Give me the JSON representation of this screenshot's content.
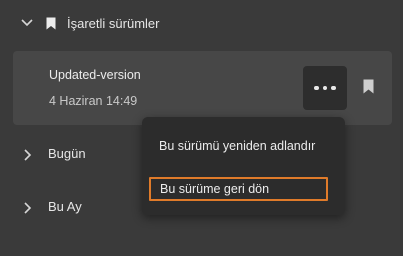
{
  "groups": {
    "marked": {
      "label": "İşaretli sürümler"
    },
    "today": {
      "label": "Bugün"
    },
    "this_month": {
      "label": "Bu Ay"
    }
  },
  "version": {
    "name": "Updated-version",
    "date": "4 Haziran 14:49"
  },
  "menu": {
    "rename_label": "Bu sürümü yeniden adlandır",
    "revert_label": "Bu sürüme geri dön"
  },
  "icons": {
    "expand": "chevron-down-icon",
    "collapsed": "chevron-right-icon",
    "bookmark": "bookmark-icon",
    "more": "more-horizontal-icon"
  },
  "colors": {
    "background": "#3a3a3a",
    "card": "#474747",
    "menu": "#2c2c2c",
    "focus_outline": "#e07b2a"
  }
}
